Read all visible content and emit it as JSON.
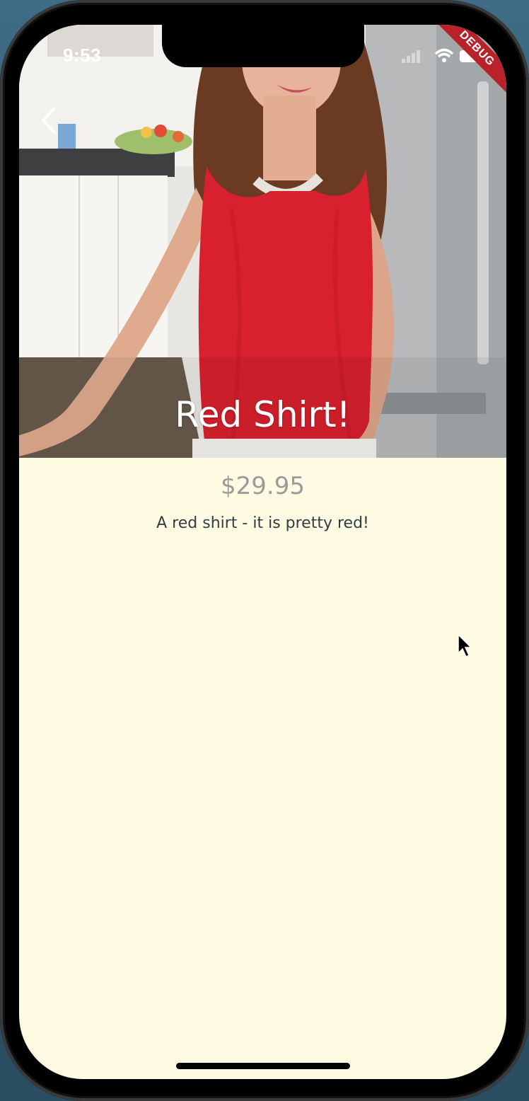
{
  "status_bar": {
    "time": "9:53"
  },
  "debug_banner": {
    "label": "DEBUG",
    "color": "#b8222b"
  },
  "nav": {
    "back_icon": "chevron-left-icon"
  },
  "product": {
    "title": "Red Shirt!",
    "price": "$29.95",
    "description": "A red shirt - it is pretty red!"
  },
  "colors": {
    "page_background": "#fffbe3",
    "price_text": "#9a9a9a",
    "description_text": "#2f3d45"
  }
}
